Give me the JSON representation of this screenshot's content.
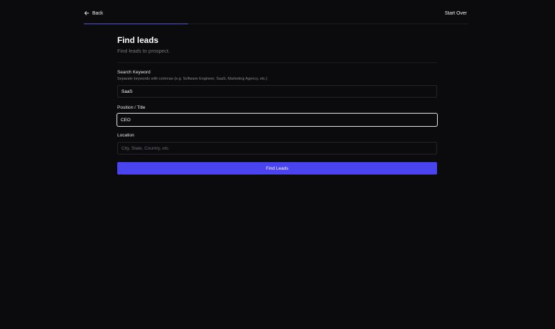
{
  "nav": {
    "back_label": "Back",
    "start_over_label": "Start Over",
    "progress": 0.27
  },
  "header": {
    "title": "Find leads",
    "subtitle": "Find leads to prospect."
  },
  "form": {
    "keyword": {
      "label": "Search Keyword",
      "hint": "Separate keywords with commas (e.g. Software Engineer, SaaS, Marketing Agency, etc.)",
      "value": "SaaS"
    },
    "position": {
      "label": "Position / Title",
      "value": "CEO"
    },
    "location": {
      "label": "Location",
      "value": "",
      "placeholder": "City, State, Country, etc."
    },
    "submit_label": "Find Leads"
  },
  "colors": {
    "accent": "#4a44f0",
    "progress": "#5a55d8",
    "background": "#0b0a0c"
  }
}
